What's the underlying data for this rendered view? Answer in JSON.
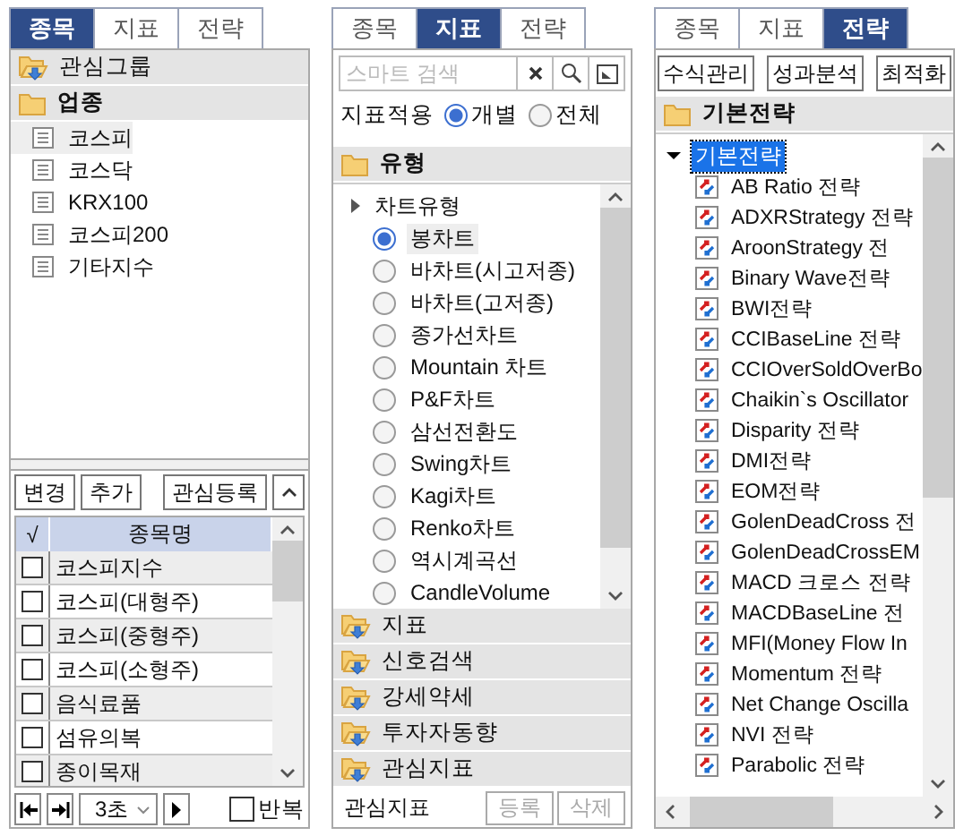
{
  "stock_panel": {
    "tabs": [
      {
        "label": "종목",
        "selected": true
      },
      {
        "label": "지표",
        "selected": false
      },
      {
        "label": "전략",
        "selected": false
      }
    ],
    "groups": [
      {
        "label": "관심그룹",
        "expanded": false
      },
      {
        "label": "업종",
        "expanded": true,
        "items": [
          {
            "label": "코스피",
            "selected": true
          },
          {
            "label": "코스닥",
            "selected": false
          },
          {
            "label": "KRX100",
            "selected": false
          },
          {
            "label": "코스피200",
            "selected": false
          },
          {
            "label": "기타지수",
            "selected": false
          }
        ]
      }
    ],
    "buttons": [
      "변경",
      "추가",
      "관심등록"
    ],
    "table": {
      "columns": [
        "√",
        "종목명"
      ],
      "rows": [
        {
          "name": "코스피지수",
          "checked": false
        },
        {
          "name": "코스피(대형주)",
          "checked": false
        },
        {
          "name": "코스피(중형주)",
          "checked": false
        },
        {
          "name": "코스피(소형주)",
          "checked": false
        },
        {
          "name": "음식료품",
          "checked": false
        },
        {
          "name": "섬유의복",
          "checked": false
        },
        {
          "name": "종이목재",
          "checked": false
        }
      ]
    },
    "interval": "3초",
    "repeat": {
      "label": "반복",
      "checked": false
    }
  },
  "indicator_panel": {
    "tabs": [
      {
        "label": "종목",
        "selected": false
      },
      {
        "label": "지표",
        "selected": true
      },
      {
        "label": "전략",
        "selected": false
      }
    ],
    "search": {
      "placeholder": "스마트 검색"
    },
    "apply_label": "지표적용",
    "apply_options": [
      {
        "label": "개별",
        "selected": true
      },
      {
        "label": "전체",
        "selected": false
      }
    ],
    "groups": [
      {
        "label": "유형",
        "expanded": true,
        "node": "차트유형",
        "chart_types": [
          {
            "label": "봉차트",
            "selected": true
          },
          {
            "label": "바차트(시고저종)",
            "selected": false
          },
          {
            "label": "바차트(고저종)",
            "selected": false
          },
          {
            "label": "종가선차트",
            "selected": false
          },
          {
            "label": "Mountain 차트",
            "selected": false
          },
          {
            "label": "P&F차트",
            "selected": false
          },
          {
            "label": "삼선전환도",
            "selected": false
          },
          {
            "label": "Swing차트",
            "selected": false
          },
          {
            "label": "Kagi차트",
            "selected": false
          },
          {
            "label": "Renko차트",
            "selected": false
          },
          {
            "label": "역시계곡선",
            "selected": false
          },
          {
            "label": "CandleVolume",
            "selected": false
          }
        ]
      },
      {
        "label": "지표",
        "expanded": false
      },
      {
        "label": "신호검색",
        "expanded": false
      },
      {
        "label": "강세약세",
        "expanded": false
      },
      {
        "label": "투자자동향",
        "expanded": false
      },
      {
        "label": "관심지표",
        "expanded": false
      }
    ],
    "footer_label": "관심지표",
    "footer_buttons": [
      {
        "label": "등록",
        "disabled": true
      },
      {
        "label": "삭제",
        "disabled": true
      }
    ]
  },
  "strategy_panel": {
    "tabs": [
      {
        "label": "종목",
        "selected": false
      },
      {
        "label": "지표",
        "selected": false
      },
      {
        "label": "전략",
        "selected": true
      }
    ],
    "buttons": [
      "수식관리",
      "성과분석",
      "최적화"
    ],
    "groups": [
      {
        "label": "기본전략",
        "expanded": true,
        "node": {
          "label": "기본전략",
          "expanded": true,
          "selected": true,
          "children": [
            "AB Ratio 전략",
            "ADXRStrategy 전략",
            "AroonStrategy 전",
            "Binary Wave전략",
            "BWI전략",
            "CCIBaseLine 전략",
            "CCIOverSoldOverBo",
            "Chaikin`s Oscillator",
            "Disparity 전략",
            "DMI전략",
            "EOM전략",
            "GolenDeadCross 전",
            "GolenDeadCrossEM",
            "MACD 크로스 전략",
            "MACDBaseLine 전",
            "MFI(Money Flow In",
            "Momentum 전략",
            "Net Change Oscilla",
            "NVI 전략",
            "Parabolic 전략"
          ]
        }
      }
    ]
  }
}
